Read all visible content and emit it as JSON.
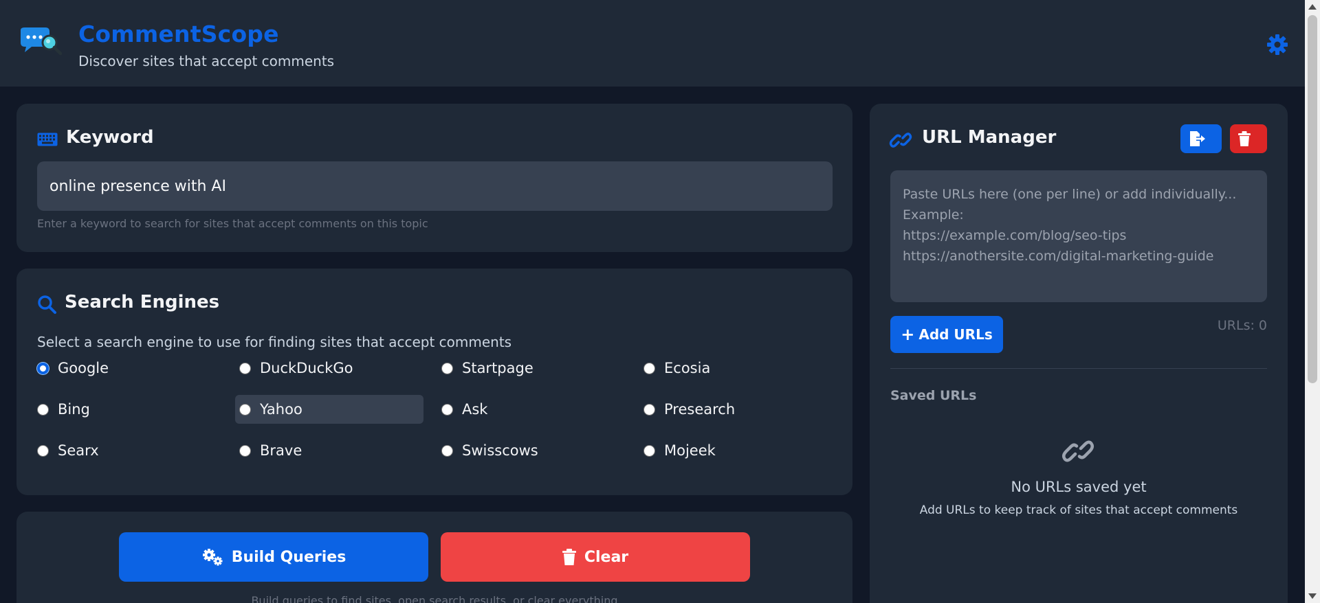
{
  "header": {
    "app_title": "CommentScope",
    "subtitle": "Discover sites that accept comments",
    "logo_icon": "chat-magnifier-icon",
    "settings_icon": "gear-icon"
  },
  "colors": {
    "accent": "#0c63e4",
    "danger": "#ef4444",
    "background": "#111827",
    "card": "#1f2937",
    "input": "#374151"
  },
  "keyword": {
    "title": "Keyword",
    "icon": "keyboard-icon",
    "value": "online presence with AI",
    "hint": "Enter a keyword to search for sites that accept comments on this topic"
  },
  "search_engines": {
    "title": "Search Engines",
    "icon": "search-icon",
    "description": "Select a search engine to use for finding sites that accept comments",
    "selected": "Google",
    "options": [
      "Google",
      "DuckDuckGo",
      "Startpage",
      "Ecosia",
      "Bing",
      "Yahoo",
      "Ask",
      "Presearch",
      "Searx",
      "Brave",
      "Swisscows",
      "Mojeek"
    ]
  },
  "actions": {
    "build_label": "Build Queries",
    "clear_label": "Clear",
    "hint": "Build queries to find sites, open search results, or clear everything"
  },
  "url_manager": {
    "title": "URL Manager",
    "icon": "link-icon",
    "textarea_placeholder": "Paste URLs here (one per line) or add individually...\nExample:\nhttps://example.com/blog/seo-tips\nhttps://anothersite.com/digital-marketing-guide",
    "add_label": "Add URLs",
    "count_text": "URLs: 0",
    "saved_label": "Saved URLs",
    "empty_title": "No URLs saved yet",
    "empty_subtitle": "Add URLs to keep track of sites that accept comments"
  }
}
